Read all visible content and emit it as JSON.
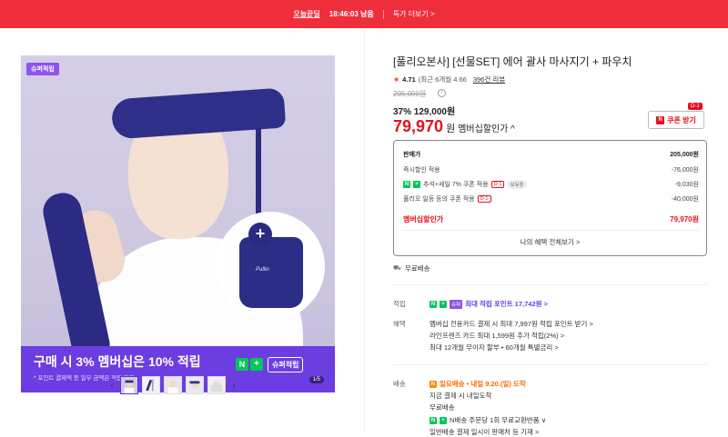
{
  "topbar": {
    "deal_label": "오늘끝딜",
    "timer": "18:46:03 남음",
    "more_link": "특가 더보기 >"
  },
  "hero": {
    "badge": "슈퍼적립",
    "banner_main": "구매 시 3% 멤버십은 10% 적립",
    "banner_sub": "* 포인트 결제액 등 일부 금액은 적립 제외",
    "npay_n": "N",
    "npay_plus": "+",
    "super_tag": "슈퍼적립",
    "page_count": "1/5",
    "pouch_brand": "Pullio"
  },
  "thumbnails": {
    "prev": "‹",
    "next": "›",
    "count": 5,
    "active_index": 0
  },
  "product": {
    "title": "[풀리오본사] [선물SET] 에어 괄사 마사지기 + 파우치",
    "rating": "4.71",
    "rating_detail": "(최근 6개월 4.66",
    "reviews": "396건 리뷰",
    "original_price": "205,000원",
    "discount_pct": "37%",
    "discount_price": "129,000원",
    "member_price": "79,970",
    "member_won": "원",
    "member_label": "멤버십할인가 ^",
    "coupon_button": "쿠폰 받기",
    "coupon_badge": "D-1"
  },
  "price_box": {
    "rows": [
      {
        "label": "판매가",
        "value": "205,000원"
      },
      {
        "label": "즉시할인 적용",
        "value": "-76,000원"
      },
      {
        "label": "추석+세일 7% 쿠폰 적용",
        "value": "-9,030원",
        "tag_d1": "D-1",
        "tag_extra": "보유중"
      },
      {
        "label": "풀리오 일등 등의 쿠폰 적용",
        "value": "-40,000원",
        "tag_d1": "D-1"
      },
      {
        "label": "멤버십할인가",
        "value": "79,970원"
      }
    ],
    "link": "나의 혜택 전체보기 >"
  },
  "shipping_free": "무료배송",
  "points": {
    "label": "적립",
    "text": "최대 적립 포인트 17,742원 >",
    "tag": "슈퍼"
  },
  "benefits": {
    "label": "혜택",
    "lines": [
      "멤버십 전용카드 결제 시 최대 7,997원 적립 포인트 받기 >",
      "라인프렌즈 카드 최대 1,599원 추가 적립(2%) >",
      "최대 12개월 무이자 할부 • 60개월 특별금리 >"
    ]
  },
  "delivery": {
    "label": "배송",
    "tag": "N",
    "arrival": "일요배송 • 내일 9.20.(일) 도착",
    "line2": "지금 결제 시 내일도착",
    "line3": "무료배송",
    "line4": "N배송 주문당 1회 무료교환반품 ∨",
    "line5": "일반배송 결제 일시이 판매처 등 기재 >"
  },
  "colors": {
    "accent_red": "#e8101e",
    "topbar": "#ef2e3c",
    "purple": "#6c3de0",
    "npay_green": "#03c75a"
  }
}
